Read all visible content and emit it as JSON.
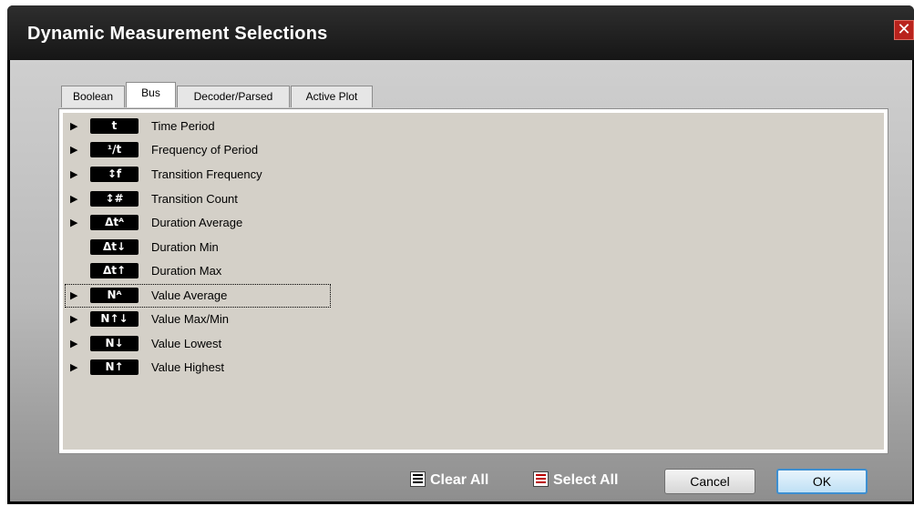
{
  "window": {
    "title": "Dynamic Measurement Selections",
    "close_label": "✕"
  },
  "tabs": [
    {
      "label": "Boolean",
      "active": false
    },
    {
      "label": "Bus",
      "active": true
    },
    {
      "label": "Decoder/Parsed",
      "active": false
    },
    {
      "label": "Active Plot",
      "active": false
    }
  ],
  "measurements": [
    {
      "badge": "t",
      "label": "Time Period",
      "expandable": true
    },
    {
      "badge": "¹/t",
      "label": "Frequency of Period",
      "expandable": true
    },
    {
      "badge": "↕f",
      "label": "Transition Frequency",
      "expandable": true
    },
    {
      "badge": "↕#",
      "label": "Transition Count",
      "expandable": true
    },
    {
      "badge": "Δtᴬ",
      "label": "Duration Average",
      "expandable": true
    },
    {
      "badge": "Δt↓",
      "label": "Duration Min",
      "expandable": false
    },
    {
      "badge": "Δt↑",
      "label": "Duration Max",
      "expandable": false
    },
    {
      "badge": "Nᴬ",
      "label": "Value Average",
      "expandable": true,
      "selected": true
    },
    {
      "badge": "N↑↓",
      "label": "Value Max/Min",
      "expandable": true
    },
    {
      "badge": "N↓",
      "label": "Value Lowest",
      "expandable": true
    },
    {
      "badge": "N↑",
      "label": "Value Highest",
      "expandable": true
    }
  ],
  "footer": {
    "clear_all": "Clear All",
    "select_all": "Select All",
    "cancel": "Cancel",
    "ok": "OK"
  },
  "colors": {
    "accent": "#3d8fd1",
    "close": "#b9221c"
  }
}
